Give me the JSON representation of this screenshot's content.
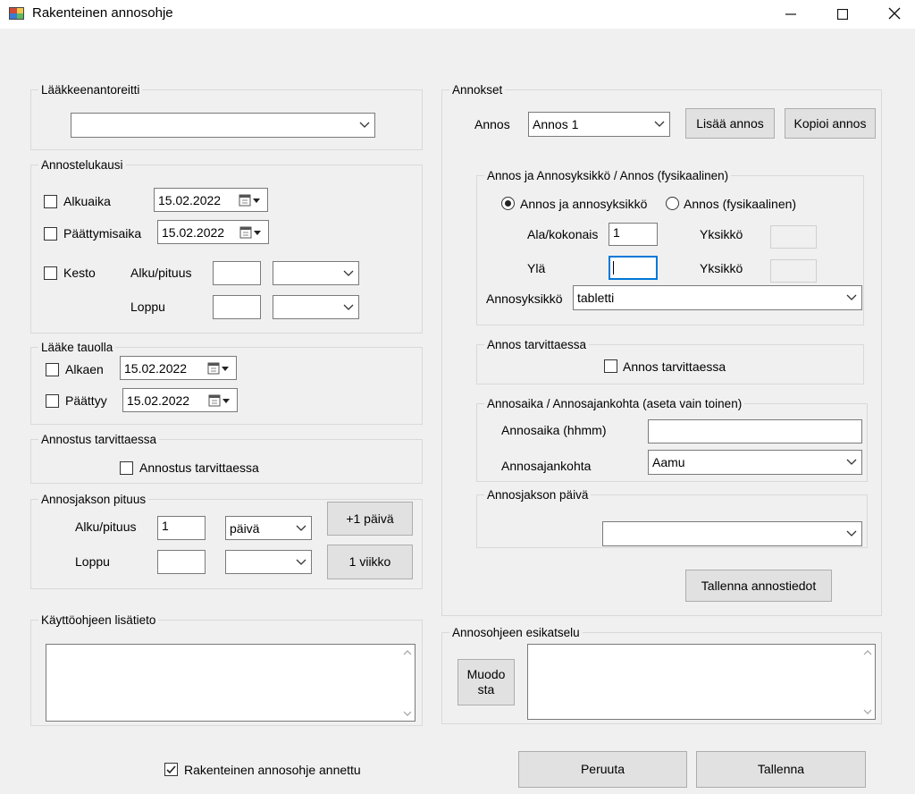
{
  "window": {
    "title": "Rakenteinen annosohje"
  },
  "route_group": {
    "label": "Lääkkeenantoreitti",
    "value": ""
  },
  "period_group": {
    "label": "Annostelukausi",
    "start_label": "Alkuaika",
    "start_date": "15.02.2022",
    "end_label": "Päättymisaika",
    "end_date": "15.02.2022",
    "duration_label": "Kesto",
    "start_length_label": "Alku/pituus",
    "end_part_label": "Loppu",
    "start_value": "",
    "start_unit": "",
    "end_value": "",
    "end_unit": ""
  },
  "break_group": {
    "label": "Lääke tauolla",
    "start_label": "Alkaen",
    "start_date": "15.02.2022",
    "end_label": "Päättyy",
    "end_date": "15.02.2022"
  },
  "prn_group": {
    "label": "Annostus tarvittaessa",
    "checkbox_label": "Annostus tarvittaessa"
  },
  "cycle_group": {
    "label": "Annosjakson pituus",
    "start_length_label": "Alku/pituus",
    "start_value": "1",
    "start_unit": "päivä",
    "end_label": "Loppu",
    "end_value": "",
    "end_unit": "",
    "plus_day_label": "+1 päivä",
    "week_label": "1 viikko"
  },
  "notes_group": {
    "label": "Käyttöohjeen lisätieto",
    "text": ""
  },
  "structured_checkbox": {
    "label": "Rakenteinen annosohje annettu",
    "checked": true
  },
  "doses_group": {
    "label": "Annokset",
    "dose_label": "Annos",
    "dose_value": "Annos 1",
    "add_label": "Lisää annos",
    "copy_label": "Kopioi annos"
  },
  "unit_group": {
    "label": "Annos ja Annosyksikkö / Annos (fysikaalinen)",
    "radio1": "Annos ja annosyksikkö",
    "radio2": "Annos (fysikaalinen)",
    "lower_label": "Ala/kokonais",
    "lower_value": "1",
    "unit1_label": "Yksikkö",
    "upper_label": "Ylä",
    "upper_value": "",
    "unit2_label": "Yksikkö",
    "dose_unit_label": "Annosyksikkö",
    "dose_unit_value": "tabletti"
  },
  "dose_prn_group": {
    "label": "Annos tarvittaessa",
    "checkbox_label": "Annos tarvittaessa"
  },
  "time_group": {
    "label": "Annosaika / Annosajankohta (aseta vain toinen)",
    "time_label": "Annosaika (hhmm)",
    "time_value": "",
    "moment_label": "Annosajankohta",
    "moment_value": "Aamu"
  },
  "day_group": {
    "label": "Annosjakson päivä",
    "value": ""
  },
  "save_dose_label": "Tallenna annostiedot",
  "preview_group": {
    "label": "Annosohjeen esikatselu",
    "build_label": "Muodo sta",
    "text": ""
  },
  "footer": {
    "cancel_label": "Peruuta",
    "save_label": "Tallenna"
  },
  "icons": [
    "app-icon",
    "minimize-icon",
    "maximize-icon",
    "close-icon",
    "dropdown-arrow-icon",
    "calendar-icon",
    "checkmark-icon",
    "scroll-up-icon",
    "scroll-down-icon"
  ]
}
